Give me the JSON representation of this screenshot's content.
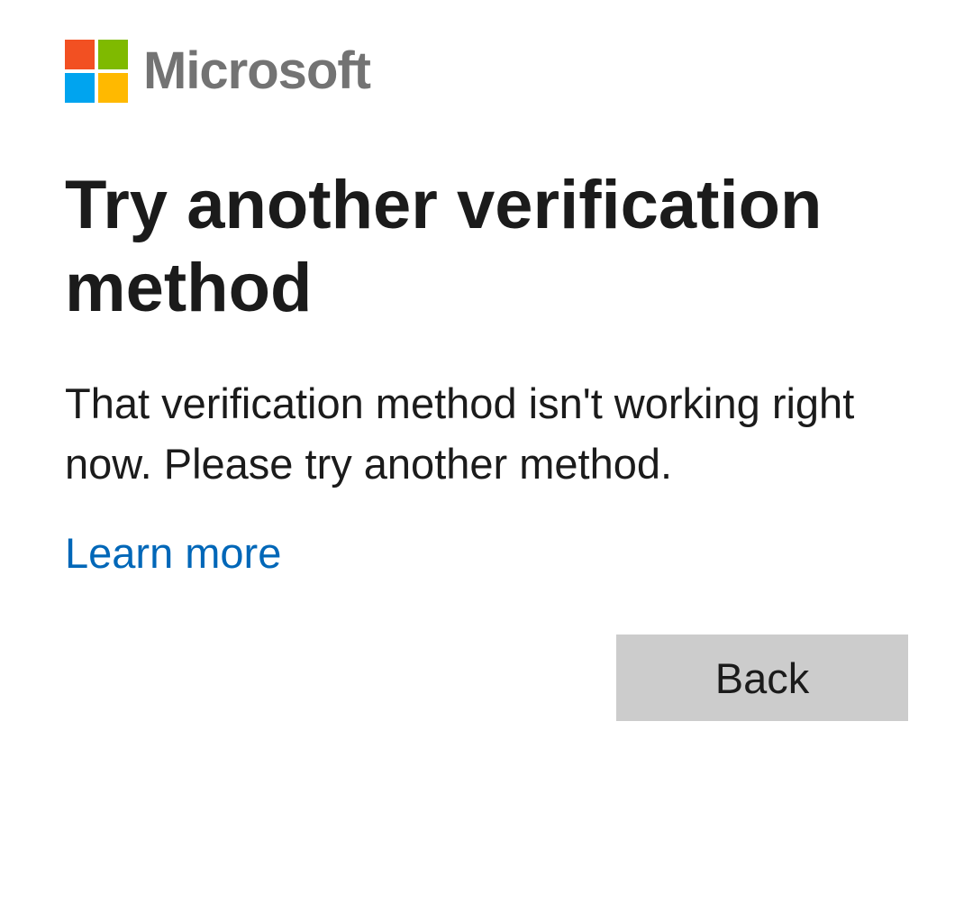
{
  "brand": {
    "name": "Microsoft",
    "logo_colors": [
      "#f25022",
      "#7fba00",
      "#00a4ef",
      "#ffb900"
    ],
    "wordmark_color": "#737373"
  },
  "page": {
    "title": "Try another verification method",
    "message": "That verification method isn't working right now. Please try another method.",
    "learn_more_label": "Learn more",
    "link_color": "#0067b8"
  },
  "actions": {
    "back_label": "Back",
    "back_button_color": "#cccccc"
  }
}
